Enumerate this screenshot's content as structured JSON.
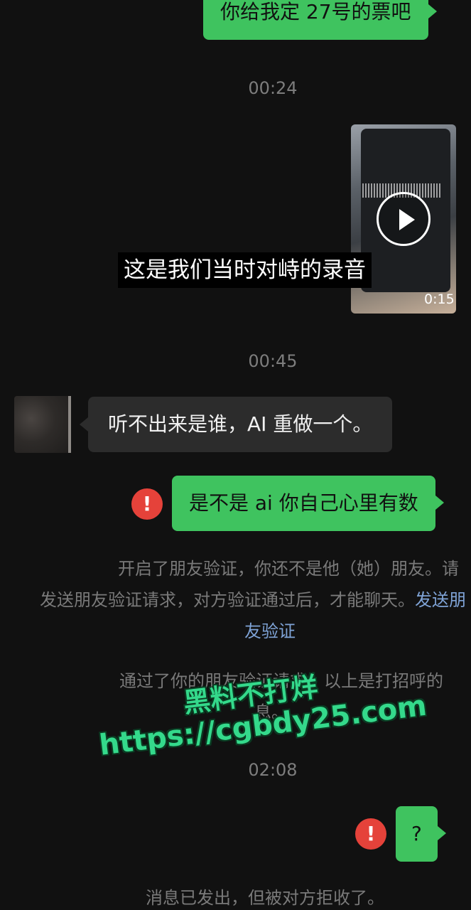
{
  "messages": {
    "msg1": "你给我定 27号的票吧",
    "msg2_caption": "这是我们当时对峙的录音",
    "msg2_duration": "0:15",
    "msg3": "听不出来是谁，AI 重做一个。",
    "msg4": "是不是 ai 你自己心里有数",
    "msg5": "?"
  },
  "timestamps": {
    "t1": "00:24",
    "t2": "00:45",
    "t3": "02:08"
  },
  "system": {
    "friend_verify_line1": "开启了朋友验证，你还不是他（她）朋友。请",
    "friend_verify_line2a": "发送朋友验证请求，对方验证通过后，才能聊天。",
    "friend_verify_link_a": "发送朋",
    "friend_verify_link_b": "友验证",
    "greet_line1": "通过了你的朋友验证请求，以上是打招呼的",
    "greet_line2": "息。",
    "rejected": "消息已发出，但被对方拒收了。"
  },
  "error_icon_glyph": "!",
  "watermark": {
    "line1": "黑料不打烊",
    "line2": "https://cgbdy25.com"
  },
  "colors": {
    "outgoing_bubble": "#3fc35f",
    "incoming_bubble": "#2c2c2c",
    "error_red": "#e5423a",
    "watermark_green": "#34d98b",
    "link_blue": "#7fa3d6"
  }
}
